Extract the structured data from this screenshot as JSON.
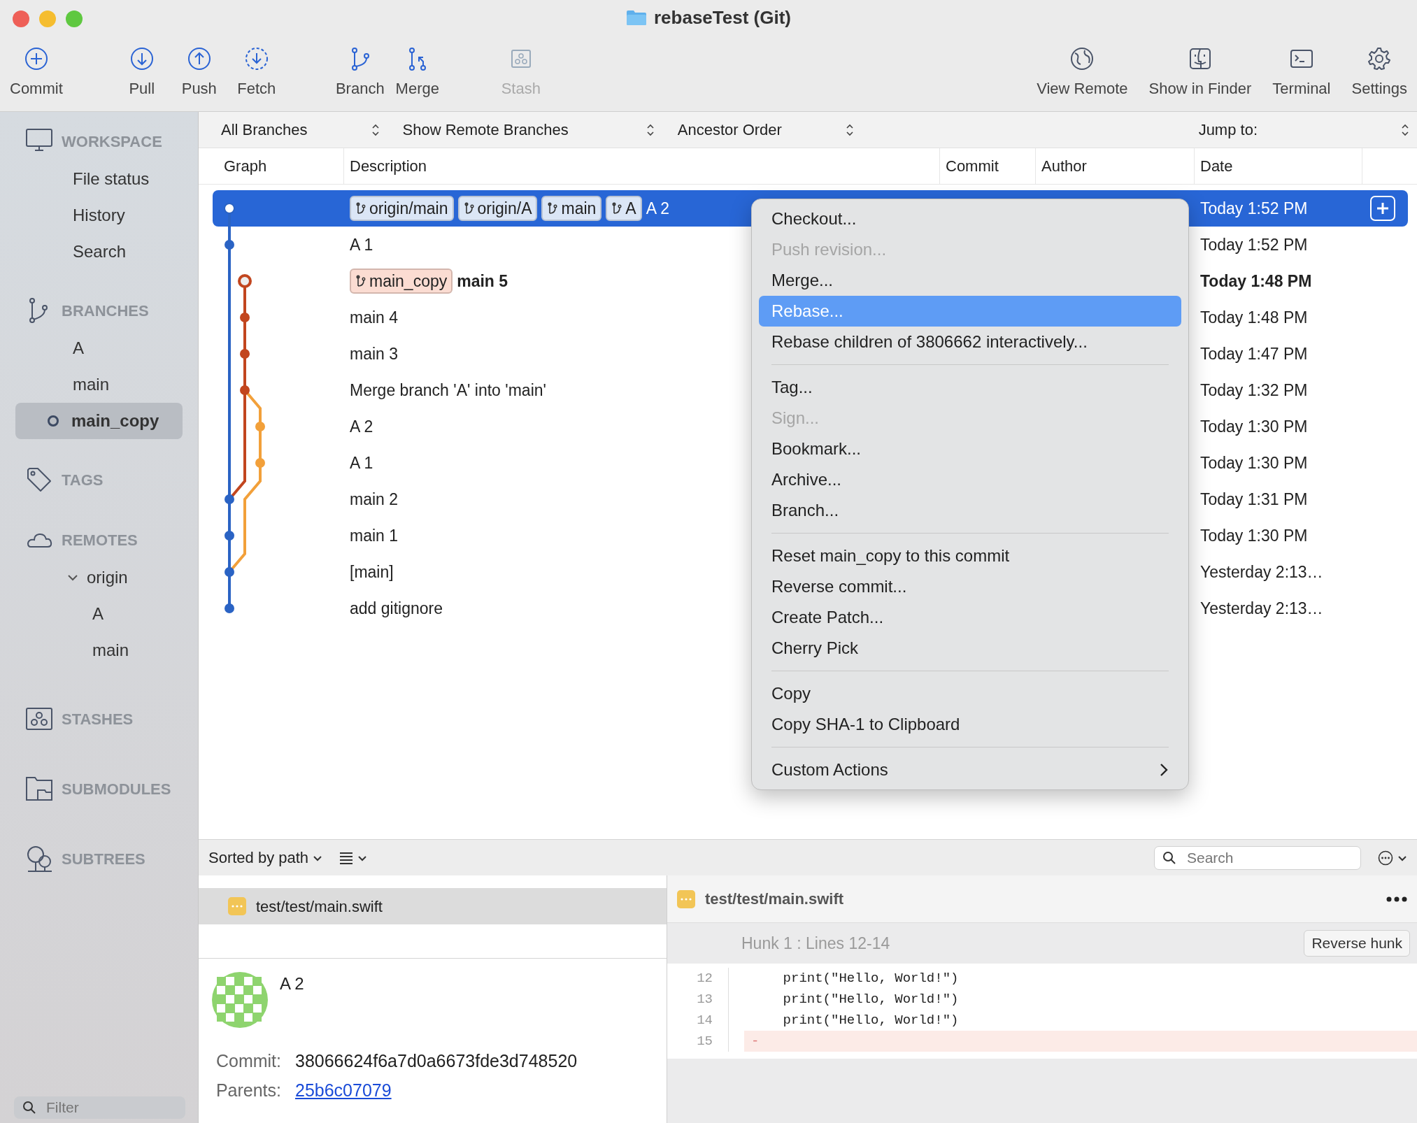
{
  "window": {
    "title": "rebaseTest (Git)"
  },
  "toolbar": {
    "groups": [
      [
        {
          "label": "Commit",
          "disabled": false
        }
      ],
      [
        {
          "label": "Pull",
          "disabled": false
        },
        {
          "label": "Push",
          "disabled": false
        },
        {
          "label": "Fetch",
          "disabled": false
        }
      ],
      [
        {
          "label": "Branch",
          "disabled": false
        },
        {
          "label": "Merge",
          "disabled": false
        }
      ],
      [
        {
          "label": "Stash",
          "disabled": true
        }
      ]
    ],
    "right": [
      {
        "label": "View Remote",
        "disabled": false
      },
      {
        "label": "Show in Finder",
        "disabled": false
      },
      {
        "label": "Terminal",
        "disabled": false
      },
      {
        "label": "Settings",
        "disabled": false
      }
    ]
  },
  "sidebar": {
    "sections": [
      {
        "title": "WORKSPACE",
        "items": [
          {
            "label": "File status",
            "selected": false,
            "current": false
          },
          {
            "label": "History",
            "selected": false,
            "current": false
          },
          {
            "label": "Search",
            "selected": false,
            "current": false
          }
        ]
      },
      {
        "title": "BRANCHES",
        "items": [
          {
            "label": "A",
            "selected": false,
            "current": false
          },
          {
            "label": "main",
            "selected": false,
            "current": false
          },
          {
            "label": "main_copy",
            "selected": true,
            "current": true
          }
        ]
      },
      {
        "title": "TAGS"
      },
      {
        "title": "REMOTES",
        "items": [
          {
            "label": "origin",
            "selected": false,
            "current": false,
            "expanded": true,
            "children": [
              {
                "label": "A",
                "selected": false,
                "current": false
              },
              {
                "label": "main",
                "selected": false,
                "current": false
              }
            ]
          }
        ]
      },
      {
        "title": "STASHES"
      },
      {
        "title": "SUBMODULES"
      },
      {
        "title": "SUBTREES"
      }
    ],
    "filter": {
      "placeholder": "Filter"
    }
  },
  "filter_bar": {
    "dropdowns": [
      "All Branches",
      "Show Remote Branches",
      "Ancestor Order"
    ],
    "jump_to": "Jump to:"
  },
  "table": {
    "columns": [
      "Graph",
      "Description",
      "Commit",
      "Author",
      "Date"
    ],
    "rows": [
      {
        "refs": [
          {
            "name": "origin/main",
            "checked_out": false
          },
          {
            "name": "origin/A",
            "checked_out": false
          },
          {
            "name": "main",
            "checked_out": false
          },
          {
            "name": "A",
            "checked_out": false
          }
        ],
        "description": "A 2",
        "date": "Today 1:52 PM",
        "selected": true,
        "head": false
      },
      {
        "refs": [],
        "description": "A 1",
        "date": "Today 1:52 PM",
        "selected": false,
        "head": false
      },
      {
        "refs": [
          {
            "name": "main_copy",
            "checked_out": true
          }
        ],
        "description": "main 5",
        "date": "Today 1:48 PM",
        "selected": false,
        "head": true
      },
      {
        "refs": [],
        "description": "main 4",
        "date": "Today 1:48 PM",
        "selected": false,
        "head": false
      },
      {
        "refs": [],
        "description": "main 3",
        "date": "Today 1:47 PM",
        "selected": false,
        "head": false
      },
      {
        "refs": [],
        "description": "Merge branch 'A' into 'main'",
        "date": "Today 1:32 PM",
        "selected": false,
        "head": false
      },
      {
        "refs": [],
        "description": "A 2",
        "date": "Today 1:30 PM",
        "selected": false,
        "head": false
      },
      {
        "refs": [],
        "description": "A 1",
        "date": "Today 1:30 PM",
        "selected": false,
        "head": false
      },
      {
        "refs": [],
        "description": "main 2",
        "date": "Today 1:31 PM",
        "selected": false,
        "head": false
      },
      {
        "refs": [],
        "description": "main 1",
        "date": "Today 1:30 PM",
        "selected": false,
        "head": false
      },
      {
        "refs": [],
        "description": "[main]",
        "date": "Yesterday 2:13…",
        "selected": false,
        "head": false
      },
      {
        "refs": [],
        "description": "add gitignore",
        "date": "Yesterday 2:13…",
        "selected": false,
        "head": false
      }
    ]
  },
  "context_menu": {
    "groups": [
      [
        {
          "label": "Checkout...",
          "kind": "action",
          "disabled": false,
          "selected": false
        },
        {
          "label": "Push revision...",
          "kind": "action",
          "disabled": true,
          "selected": false
        },
        {
          "label": "Merge...",
          "kind": "action",
          "disabled": false,
          "selected": false
        },
        {
          "label": "Rebase...",
          "kind": "action",
          "disabled": false,
          "selected": true
        },
        {
          "label": "Rebase children of 3806662 interactively...",
          "kind": "action",
          "disabled": false,
          "selected": false
        }
      ],
      [
        {
          "label": "Tag...",
          "kind": "action",
          "disabled": false,
          "selected": false
        },
        {
          "label": "Sign...",
          "kind": "action",
          "disabled": true,
          "selected": false
        },
        {
          "label": "Bookmark...",
          "kind": "action",
          "disabled": false,
          "selected": false
        },
        {
          "label": "Archive...",
          "kind": "action",
          "disabled": false,
          "selected": false
        },
        {
          "label": "Branch...",
          "kind": "action",
          "disabled": false,
          "selected": false
        }
      ],
      [
        {
          "label": "Reset main_copy to this commit",
          "kind": "action",
          "disabled": false,
          "selected": false
        },
        {
          "label": "Reverse commit...",
          "kind": "action",
          "disabled": false,
          "selected": false
        },
        {
          "label": "Create Patch...",
          "kind": "action",
          "disabled": false,
          "selected": false
        },
        {
          "label": "Cherry Pick",
          "kind": "action",
          "disabled": false,
          "selected": false
        }
      ],
      [
        {
          "label": "Copy",
          "kind": "action",
          "disabled": false,
          "selected": false
        },
        {
          "label": "Copy SHA-1 to Clipboard",
          "kind": "action",
          "disabled": false,
          "selected": false
        }
      ],
      [
        {
          "label": "Custom Actions",
          "kind": "submenu",
          "disabled": false,
          "selected": false
        }
      ]
    ]
  },
  "bottom_bar": {
    "sort": "Sorted by path",
    "search": {
      "placeholder": "Search"
    }
  },
  "files": [
    {
      "path": "test/test/main.swift",
      "selected": true
    }
  ],
  "commit_details": {
    "title": "A 2",
    "fields": [
      {
        "label": "Commit:",
        "value": "38066624f6a7d0a6673fde3d748520",
        "kind": "text"
      },
      {
        "label": "Parents:",
        "value": "25b6c07079",
        "kind": "link"
      }
    ]
  },
  "diff": {
    "file": "test/test/main.swift",
    "hunk": "Hunk 1 : Lines 12-14",
    "reverse_button": "Reverse hunk",
    "lines": [
      {
        "number": "12",
        "text": "    print(\"Hello, World!\")",
        "kind": "context"
      },
      {
        "number": "13",
        "text": "    print(\"Hello, World!\")",
        "kind": "context"
      },
      {
        "number": "14",
        "text": "    print(\"Hello, World!\")",
        "kind": "context"
      },
      {
        "number": "15",
        "text": "-",
        "kind": "removed"
      }
    ]
  }
}
